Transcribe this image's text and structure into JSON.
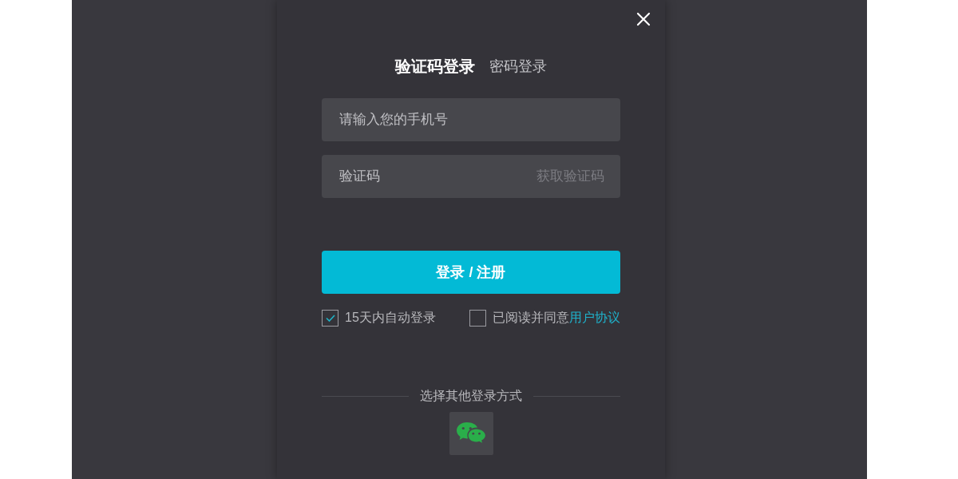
{
  "tabs": [
    {
      "label": "验证码登录",
      "selected": true
    },
    {
      "label": "密码登录",
      "selected": false
    }
  ],
  "fields": [
    {
      "placeholder": "请输入您的手机号"
    },
    {
      "placeholder": "验证码",
      "action": "获取验证码"
    }
  ],
  "submit_button": {
    "label": "登录 / 注册"
  },
  "options": [
    {
      "label": "15天内自动登录",
      "checked": true
    },
    {
      "label": "已阅读并同意",
      "link": "用户协议",
      "checked": false
    }
  ],
  "other_login": {
    "label": "选择其他登录方式"
  }
}
